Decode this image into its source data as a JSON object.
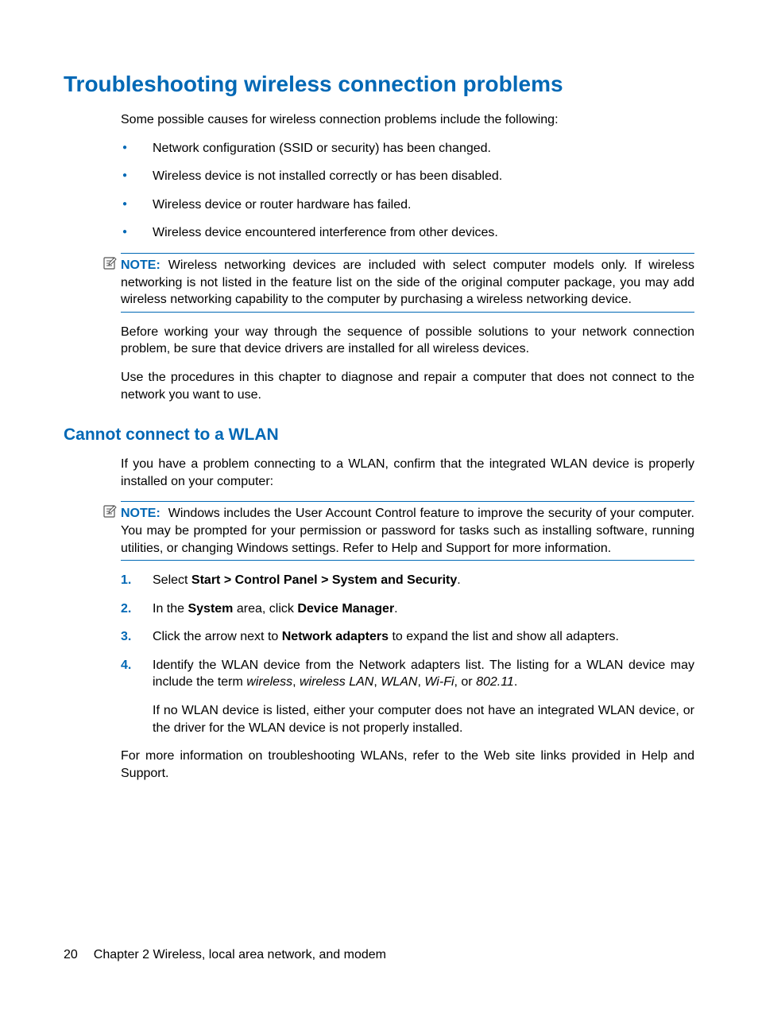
{
  "heading1": "Troubleshooting wireless connection problems",
  "intro1": "Some possible causes for wireless connection problems include the following:",
  "bullets1": [
    "Network configuration (SSID or security) has been changed.",
    "Wireless device is not installed correctly or has been disabled.",
    "Wireless device or router hardware has failed.",
    "Wireless device encountered interference from other devices."
  ],
  "note1": {
    "label": "NOTE:",
    "text": "Wireless networking devices are included with select computer models only. If wireless networking is not listed in the feature list on the side of the original computer package, you may add wireless networking capability to the computer by purchasing a wireless networking device."
  },
  "para1": "Before working your way through the sequence of possible solutions to your network connection problem, be sure that device drivers are installed for all wireless devices.",
  "para2": "Use the procedures in this chapter to diagnose and repair a computer that does not connect to the network you want to use.",
  "heading2": "Cannot connect to a WLAN",
  "intro2": "If you have a problem connecting to a WLAN, confirm that the integrated WLAN device is properly installed on your computer:",
  "note2": {
    "label": "NOTE:",
    "text": "Windows includes the User Account Control feature to improve the security of your computer. You may be prompted for your permission or password for tasks such as installing software, running utilities, or changing Windows settings. Refer to Help and Support for more information."
  },
  "steps": {
    "s1": {
      "num": "1.",
      "pre": "Select ",
      "bold": "Start > Control Panel > System and Security",
      "post": "."
    },
    "s2": {
      "num": "2.",
      "pre": "In the ",
      "b1": "System",
      "mid": " area, click ",
      "b2": "Device Manager",
      "post": "."
    },
    "s3": {
      "num": "3.",
      "pre": "Click the arrow next to ",
      "bold": "Network adapters",
      "post": " to expand the list and show all adapters."
    },
    "s4": {
      "num": "4.",
      "pre": "Identify the WLAN device from the Network adapters list. The listing for a WLAN device may include the term ",
      "i1": "wireless",
      "c1": ", ",
      "i2": "wireless LAN",
      "c2": ", ",
      "i3": "WLAN",
      "c3": ", ",
      "i4": "Wi-Fi",
      "c4": ", or ",
      "i5": "802.11",
      "post": ".",
      "sub": "If no WLAN device is listed, either your computer does not have an integrated WLAN device, or the driver for the WLAN device is not properly installed."
    }
  },
  "para3": "For more information on troubleshooting WLANs, refer to the Web site links provided in Help and Support.",
  "footer": {
    "page": "20",
    "chapter": "Chapter 2   Wireless, local area network, and modem"
  }
}
